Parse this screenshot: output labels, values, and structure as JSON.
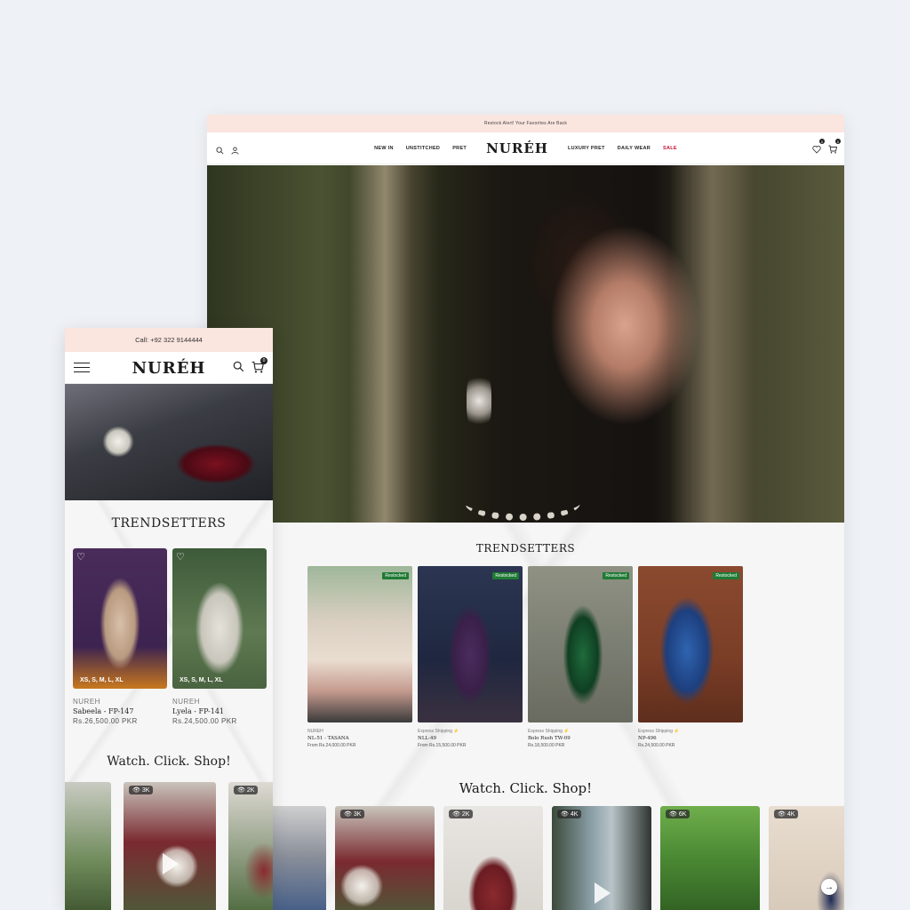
{
  "desktop": {
    "announcement": "Restock Alert! Your Favorites Are Back",
    "logo": "NURÉH",
    "menu": [
      {
        "label": "NEW IN"
      },
      {
        "label": "UNSTITCHED"
      },
      {
        "label": "PRET"
      },
      {
        "label": "LUXURY PRET"
      },
      {
        "label": "DAILY WEAR"
      },
      {
        "label": "SALE"
      }
    ],
    "wishlist_count": "0",
    "cart_count": "0",
    "trendsetters_title": "TRENDSETTERS",
    "products": [
      {
        "tag": "Restocked",
        "line1": "NUREH",
        "name": "NL-51 - TASANA",
        "price": "From Rs.24,000.00 PKR"
      },
      {
        "tag": "Restocked",
        "line1": "Express Shipping ⚡",
        "name": "NLL-49",
        "price": "From Rs.15,500.00 PKR"
      },
      {
        "tag": "Restocked",
        "line1": "Express Shipping ⚡",
        "name": "Bolo Rush TW-09",
        "price": "Rs.18,500.00 PKR"
      },
      {
        "tag": "Restocked",
        "line1": "Express Shipping ⚡",
        "name": "NP-496",
        "price": "Rs.24,500.00 PKR"
      }
    ],
    "watch_title": "Watch. Click. Shop!",
    "videos": [
      {
        "views": ""
      },
      {
        "views": "3K"
      },
      {
        "views": "2K"
      },
      {
        "views": "4K"
      },
      {
        "views": "6K"
      },
      {
        "views": "4K"
      }
    ],
    "next_arrow": "→"
  },
  "mobile": {
    "announcement": "Call: +92 322 9144444",
    "logo": "NURÉH",
    "cart_count": "0",
    "trendsetters_title": "TRENDSETTERS",
    "products": [
      {
        "sizes": "XS, S, M, L, XL",
        "brand": "NUREH",
        "name": "Sabeela - FP-147",
        "price": "Rs.26,500.00 PKR"
      },
      {
        "sizes": "XS, S, M, L, XL",
        "brand": "NUREH",
        "name": "Lyela - FP-141",
        "price": "Rs.24,500.00 PKR"
      }
    ],
    "watch_title": "Watch. Click. Shop!",
    "videos": [
      {
        "views": ""
      },
      {
        "views": "3K"
      },
      {
        "views": "2K"
      }
    ]
  },
  "colors": {
    "announce_bg": "#fbe5df",
    "sale": "#c8102e",
    "restocked_tag": "#1f7a34",
    "page_bg": "#eef1f5"
  }
}
